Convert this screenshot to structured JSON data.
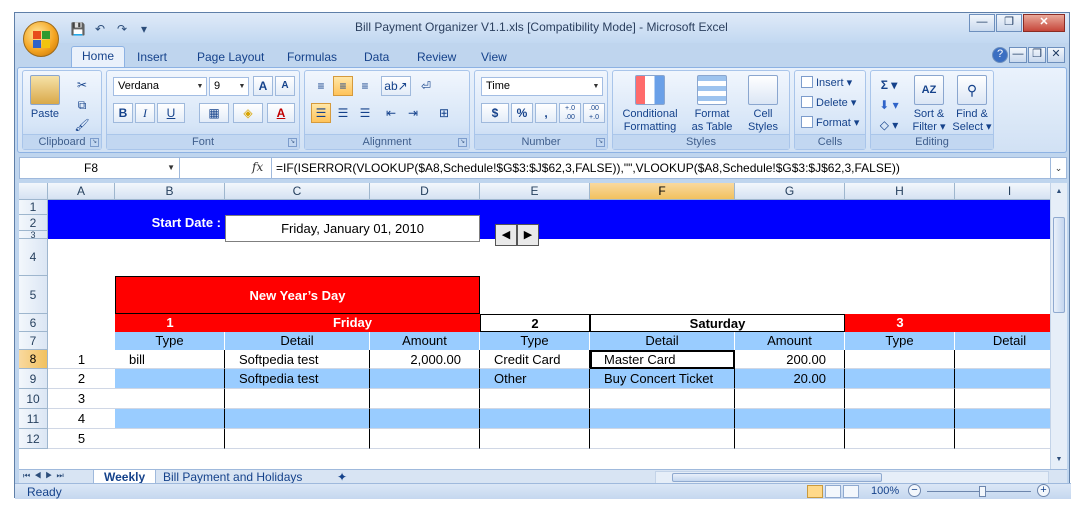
{
  "window": {
    "title": "Bill Payment Organizer V1.1.xls  [Compatibility Mode] - Microsoft Excel"
  },
  "ribbon": {
    "tabs": [
      "Home",
      "Insert",
      "Page Layout",
      "Formulas",
      "Data",
      "Review",
      "View"
    ],
    "active_tab": "Home",
    "groups": {
      "clipboard": {
        "label": "Clipboard",
        "paste": "Paste"
      },
      "font": {
        "label": "Font",
        "font_name": "Verdana",
        "font_size": "9",
        "bold": "B",
        "italic": "I",
        "underline": "U",
        "grow": "A",
        "shrink": "A"
      },
      "alignment": {
        "label": "Alignment"
      },
      "number": {
        "label": "Number",
        "format": "Time",
        "currency": "$",
        "percent": "%",
        "comma": ",",
        "inc_dec": "+.0 .00",
        "dec_dec": ".00 +.0"
      },
      "styles": {
        "label": "Styles",
        "conditional": "Conditional",
        "conditional2": "Formatting",
        "format_table": "Format",
        "format_table2": "as Table",
        "cell_styles": "Cell",
        "cell_styles2": "Styles"
      },
      "cells": {
        "label": "Cells",
        "insert": "Insert",
        "delete": "Delete",
        "format": "Format"
      },
      "editing": {
        "label": "Editing",
        "sort": "Sort &",
        "sort2": "Filter",
        "find": "Find &",
        "find2": "Select"
      }
    }
  },
  "formula_bar": {
    "name_box": "F8",
    "fx": "fx",
    "formula": "=IF(ISERROR(VLOOKUP($A8,Schedule!$G$3:$J$62,3,FALSE)),\"\",VLOOKUP($A8,Schedule!$G$3:$J$62,3,FALSE))"
  },
  "grid": {
    "columns": [
      "A",
      "B",
      "C",
      "D",
      "E",
      "F",
      "G",
      "H",
      "I"
    ],
    "rows": [
      "1",
      "2",
      "3",
      "4",
      "5",
      "6",
      "7",
      "8",
      "9",
      "10",
      "11",
      "12"
    ],
    "selected_col": "F",
    "selected_row": "8",
    "start_date_label": "Start Date :",
    "start_date_value": "Friday, January 01, 2010",
    "holiday": "New Year’s Day",
    "day1": {
      "num": "1",
      "name": "Friday"
    },
    "day2": {
      "num": "2",
      "name": "Saturday"
    },
    "day3": {
      "num": "3"
    },
    "headers": {
      "type": "Type",
      "detail": "Detail",
      "amount": "Amount"
    },
    "entries": [
      {
        "no": "1",
        "type1": "bill",
        "detail1": "Softpedia test",
        "amount1": "2,000.00",
        "type2": "Credit Card",
        "detail2": "Master Card",
        "amount2": "200.00"
      },
      {
        "no": "2",
        "type1": "",
        "detail1": "Softpedia test",
        "amount1": "",
        "type2": "Other",
        "detail2": "Buy Concert Ticket",
        "amount2": "20.00"
      },
      {
        "no": "3"
      },
      {
        "no": "4"
      },
      {
        "no": "5"
      }
    ]
  },
  "sheets": {
    "tabs": [
      "Weekly",
      "Bill Payment and Holidays"
    ],
    "active": "Weekly"
  },
  "status": {
    "text": "Ready",
    "zoom": "100%"
  },
  "colors": {
    "banner_blue": "#0000ff",
    "header_red": "#ff0000",
    "row_light_blue": "#99ccff",
    "selection_orange": "#f1c15f"
  }
}
